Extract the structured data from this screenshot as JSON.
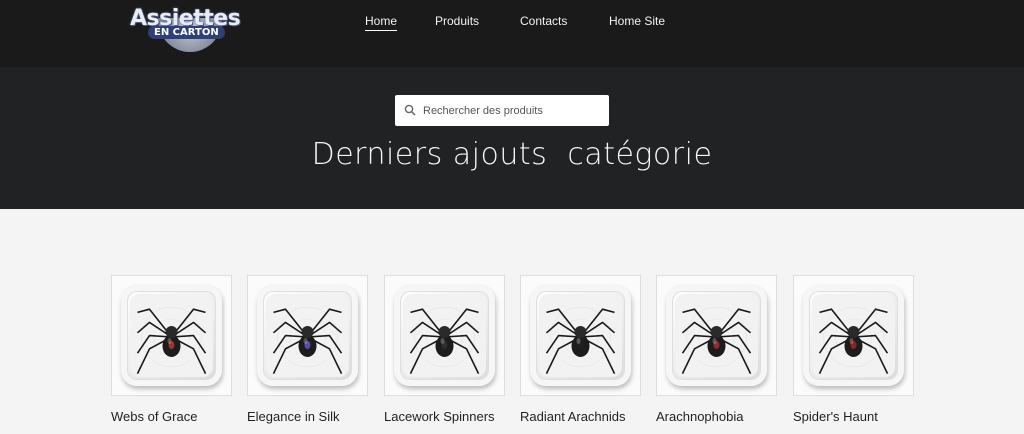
{
  "logo": {
    "main": "Assiettes",
    "sub": "EN CARTON"
  },
  "nav": {
    "items": [
      {
        "label": "Home",
        "active": true
      },
      {
        "label": "Produits",
        "active": false
      },
      {
        "label": "Contacts",
        "active": false
      },
      {
        "label": "Home Site",
        "active": false
      }
    ]
  },
  "search": {
    "placeholder": "Rechercher des produits",
    "icon": "search-icon"
  },
  "hero": {
    "title": "Derniers ajouts  catégorie"
  },
  "products": [
    {
      "name": "Webs of Grace",
      "image": "spider-plate",
      "accent": "#c0392b"
    },
    {
      "name": "Elegance in Silk",
      "image": "spider-plate",
      "accent": "#6a5acd"
    },
    {
      "name": "Lacework Spinners",
      "image": "spider-plate",
      "accent": "#333333"
    },
    {
      "name": "Radiant Arachnids",
      "image": "spider-plate",
      "accent": "#222222"
    },
    {
      "name": "Arachnophobia",
      "image": "spider-plate",
      "accent": "#b03030"
    },
    {
      "name": "Spider's Haunt",
      "image": "spider-plate",
      "accent": "#b22222"
    }
  ],
  "colors": {
    "header_bg": "#1a1a1a",
    "hero_bg": "#212224",
    "page_bg": "#f4f4f4"
  }
}
